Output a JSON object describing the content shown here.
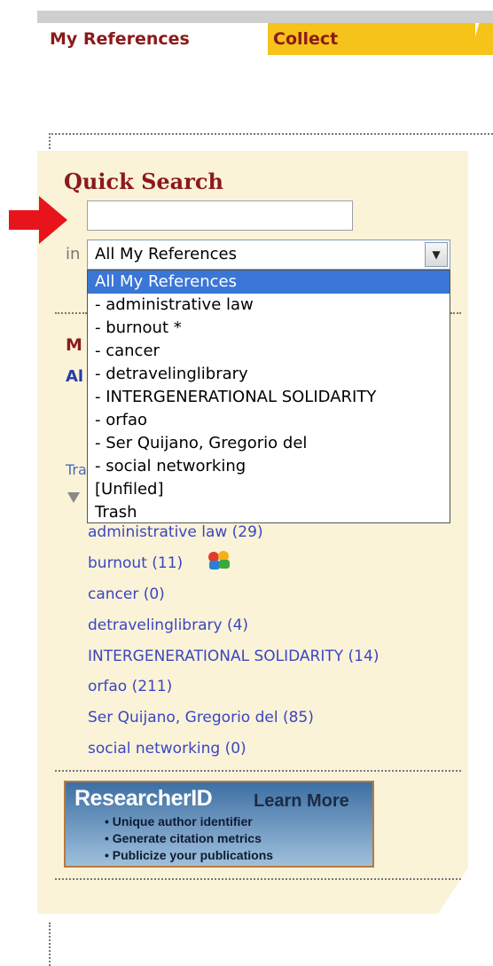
{
  "tabs": {
    "active": "My References",
    "collect": "Collect"
  },
  "quick_search": {
    "title": "Quick Search",
    "input_value": "",
    "in_label": "in",
    "selected": "All My References",
    "options": [
      "All My References",
      "- administrative law",
      "- burnout *",
      "- cancer",
      "- detravelinglibrary",
      "- INTERGENERATIONAL SOLIDARITY",
      "- orfao",
      "- Ser Quijano, Gregorio del",
      "- social networking",
      "[Unfiled]",
      "Trash"
    ]
  },
  "hidden_peek": {
    "m": "M",
    "a": "Al",
    "t": "Tra"
  },
  "groups": [
    "administrative law (29)",
    "burnout (11)",
    "cancer (0)",
    "detravelinglibrary (4)",
    "INTERGENERATIONAL SOLIDARITY (14)",
    "orfao (211)",
    "Ser Quijano, Gregorio del (85)",
    "social networking (0)"
  ],
  "banner": {
    "brand": "ResearcherID",
    "learn_more": "Learn More",
    "bullets": [
      "• Unique author identifier",
      "• Generate citation metrics",
      "• Publicize your publications"
    ]
  },
  "colors": {
    "accent": "#8b1a1a",
    "link": "#3a46c2",
    "tab_yellow": "#f5c319",
    "panel": "#fbf3d7",
    "highlight": "#3a76d6"
  },
  "icons": {
    "arrow": "red-pointer-arrow",
    "share": "shared-group-icon",
    "dropdown": "chevron-down-icon"
  }
}
